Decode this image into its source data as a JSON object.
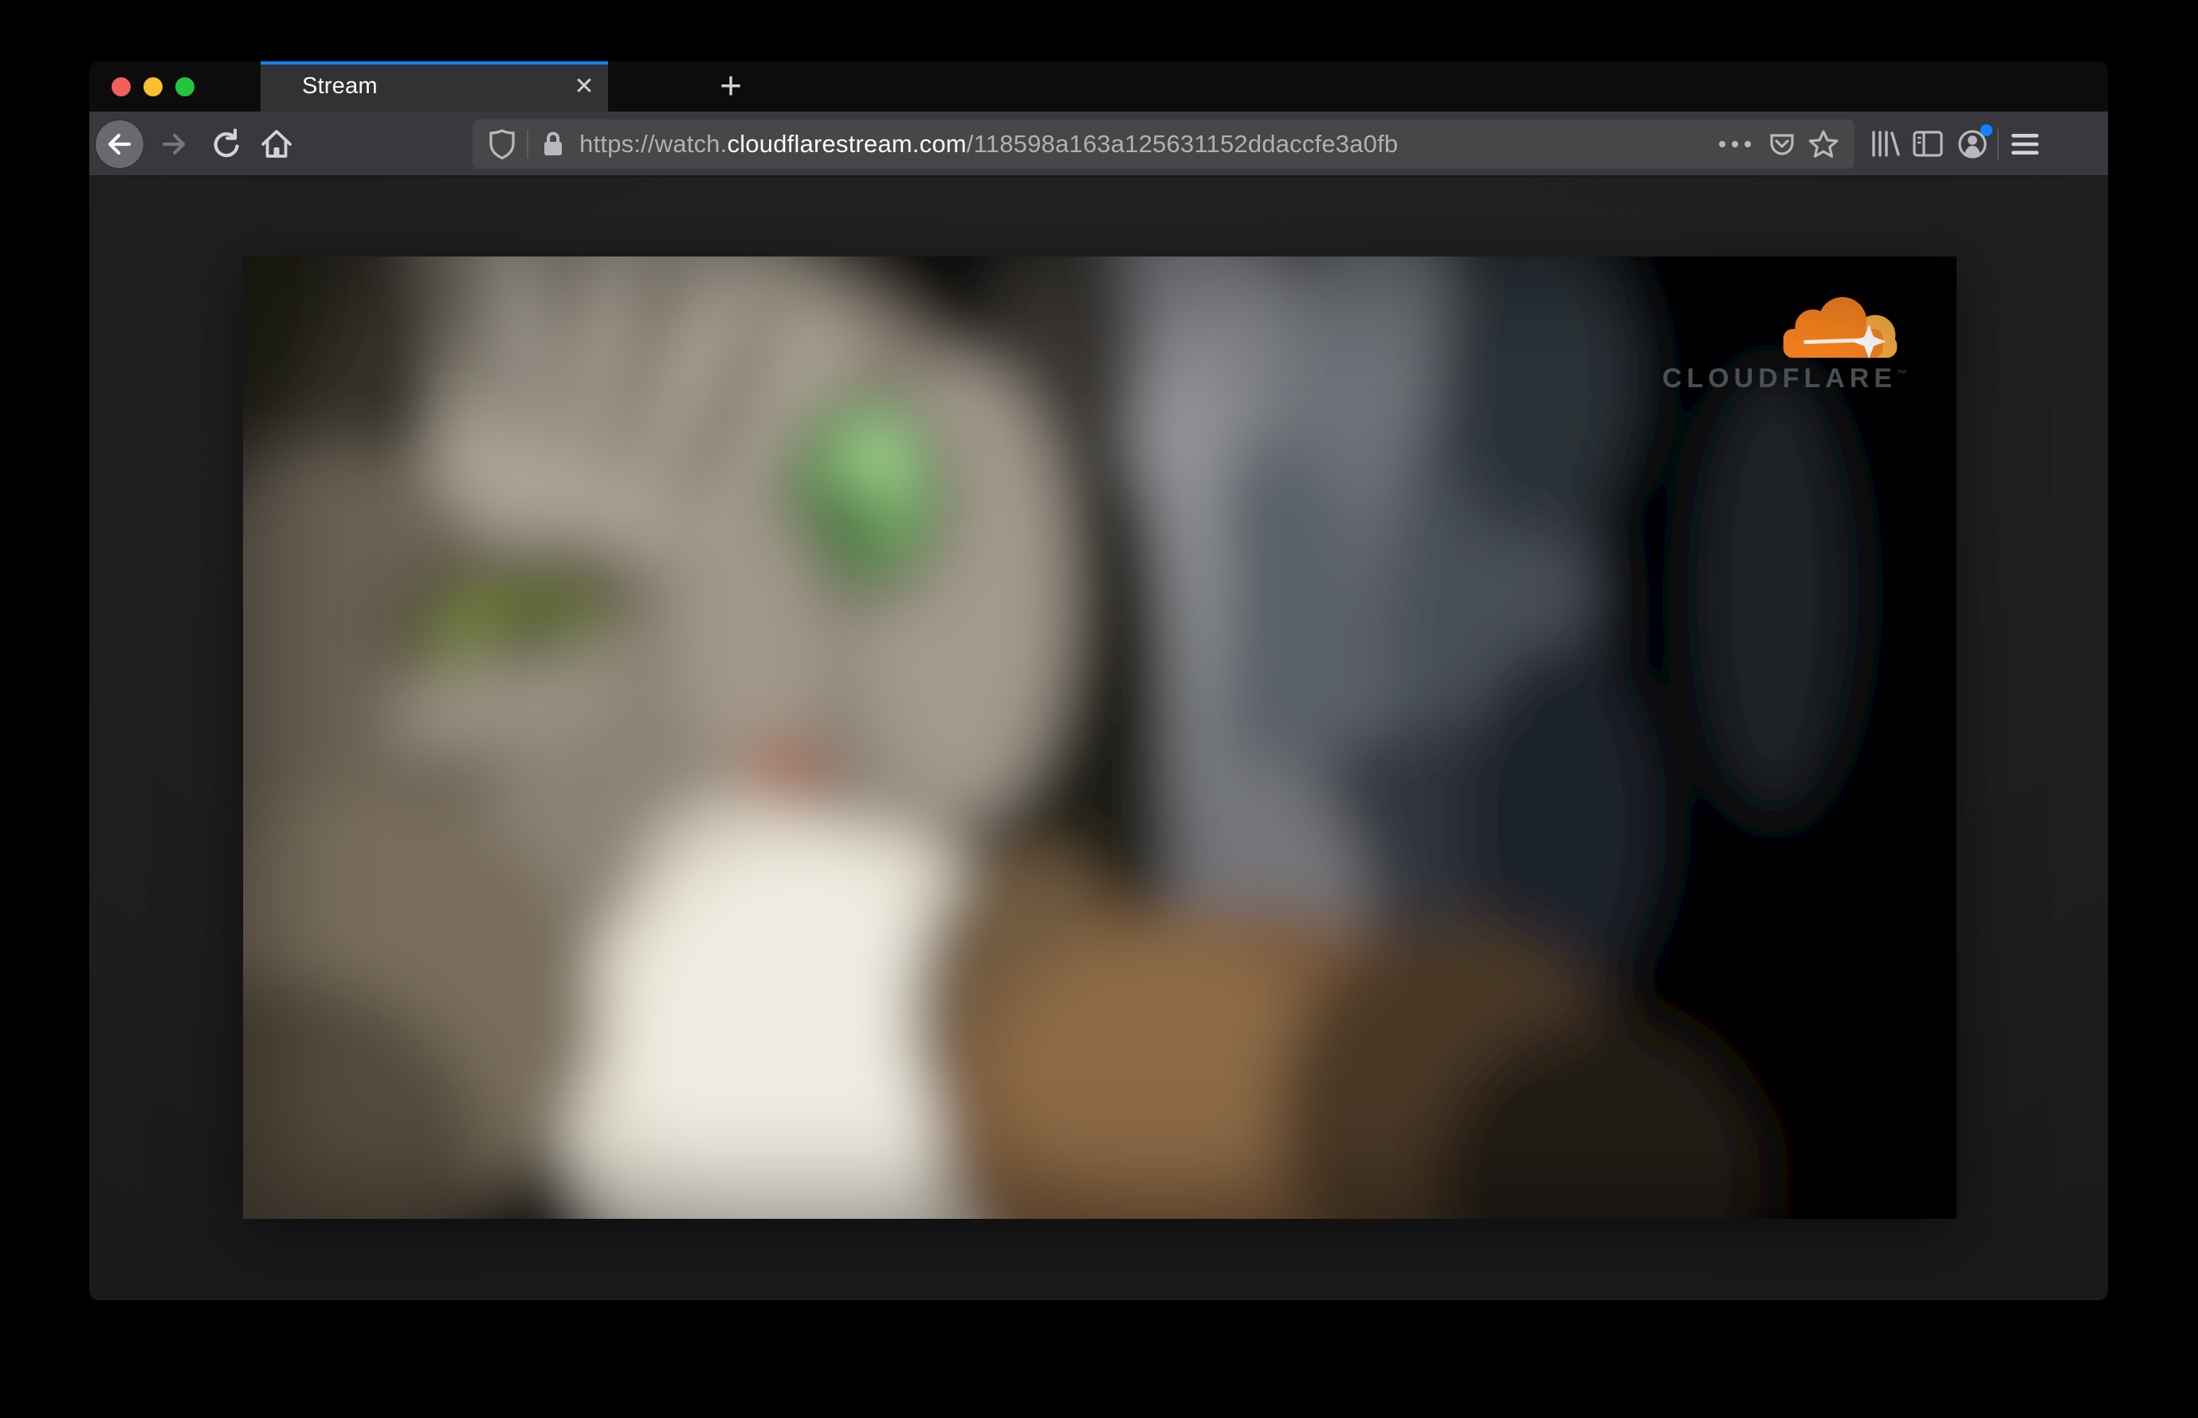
{
  "browser": {
    "tab": {
      "title": "Stream",
      "close_glyph": "✕"
    },
    "new_tab_glyph": "+"
  },
  "urlbar": {
    "scheme": "https://watch.",
    "domain": "cloudflarestream.com",
    "path": "/118598a163a125631152ddaccfe3a0fb"
  },
  "video": {
    "brand_text": "CLOUDFLARE",
    "brand_trademark": "™"
  },
  "colors": {
    "tab_accent": "#0a84ff",
    "notification_dot": "#0a84ff",
    "traffic_red": "#f25f58",
    "traffic_yellow": "#fabe2f",
    "traffic_green": "#22c53d",
    "cloudflare_orange": "#f6821f",
    "cloudflare_light_orange": "#fbad41"
  },
  "icons": {
    "toolbar": [
      "back-icon",
      "forward-icon",
      "reload-icon",
      "home-icon"
    ],
    "urlbar": [
      "tracking-shield-icon",
      "lock-icon",
      "page-actions-icon",
      "pocket-icon",
      "bookmark-star-icon"
    ],
    "right": [
      "library-icon",
      "sidebar-icon",
      "account-icon",
      "menu-icon"
    ]
  }
}
